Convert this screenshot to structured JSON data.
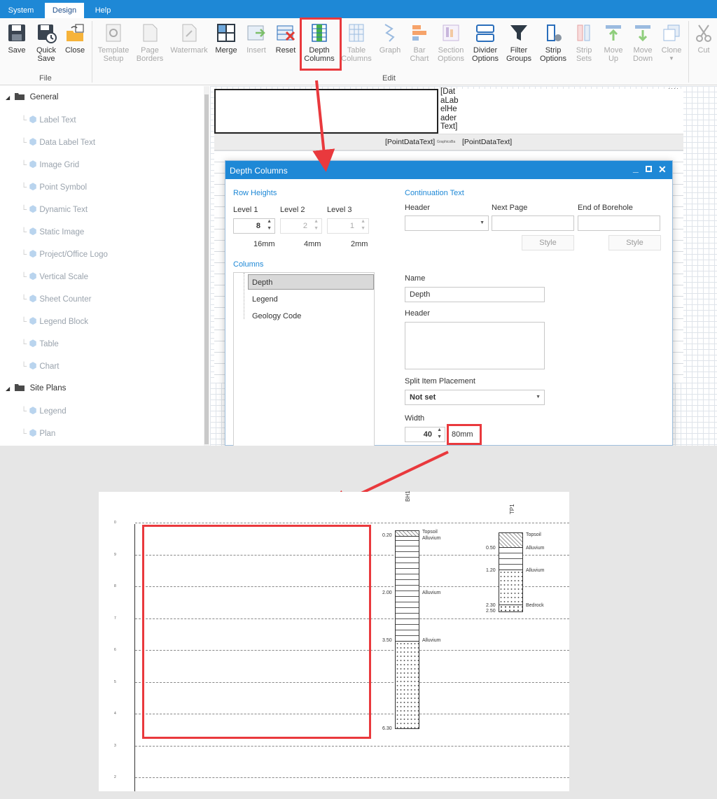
{
  "tabs": [
    {
      "label": "System",
      "active": false
    },
    {
      "label": "Design",
      "active": true
    },
    {
      "label": "Help",
      "active": false
    }
  ],
  "ribbon": {
    "file_group": "File",
    "edit_group": "Edit",
    "buttons": {
      "save": {
        "label": "Save",
        "enabled": true
      },
      "quick_save": {
        "label": "Quick\nSave",
        "enabled": true
      },
      "close": {
        "label": "Close",
        "enabled": true
      },
      "template_setup": {
        "label": "Template\nSetup",
        "enabled": false
      },
      "page_borders": {
        "label": "Page\nBorders",
        "enabled": false
      },
      "watermark": {
        "label": "Watermark",
        "enabled": false
      },
      "merge": {
        "label": "Merge",
        "enabled": true
      },
      "insert": {
        "label": "Insert",
        "enabled": false
      },
      "reset": {
        "label": "Reset",
        "enabled": true
      },
      "depth_columns": {
        "label": "Depth\nColumns",
        "enabled": true
      },
      "table_columns": {
        "label": "Table\nColumns",
        "enabled": false
      },
      "graph": {
        "label": "Graph",
        "enabled": false
      },
      "bar_chart": {
        "label": "Bar\nChart",
        "enabled": false
      },
      "section_options": {
        "label": "Section\nOptions",
        "enabled": false
      },
      "divider_options": {
        "label": "Divider\nOptions",
        "enabled": true
      },
      "filter_groups": {
        "label": "Filter\nGroups",
        "enabled": true
      },
      "strip_options": {
        "label": "Strip\nOptions",
        "enabled": true
      },
      "strip_sets": {
        "label": "Strip\nSets",
        "enabled": false
      },
      "move_up": {
        "label": "Move\nUp",
        "enabled": false
      },
      "move_down": {
        "label": "Move\nDown",
        "enabled": false
      },
      "clone": {
        "label": "Clone",
        "enabled": false
      },
      "cut": {
        "label": "Cut",
        "enabled": false
      }
    }
  },
  "tree": {
    "groups": [
      {
        "label": "General",
        "items": [
          "Label Text",
          "Data Label Text",
          "Image Grid",
          "Point Symbol",
          "Dynamic Text",
          "Static Image",
          "Project/Office Logo",
          "Vertical Scale",
          "Sheet Counter",
          "Legend Block",
          "Table",
          "Chart"
        ]
      },
      {
        "label": "Site Plans",
        "items": [
          "Legend",
          "Plan"
        ]
      }
    ]
  },
  "canvas": {
    "header_text_lines": [
      "[Dat",
      "aLab",
      "elHe",
      "ader",
      "Text]"
    ],
    "point_data_text": "[PointDataText]",
    "graphics_text": "GraphicsBa",
    "point_data_text_2": "[PointDataText]"
  },
  "dialog": {
    "title": "Depth Columns",
    "row_heights": {
      "section": "Row Heights",
      "level1_label": "Level 1",
      "level2_label": "Level 2",
      "level3_label": "Level 3",
      "level1_value": "8",
      "level2_value": "2",
      "level3_value": "1",
      "level1_mm": "16mm",
      "level2_mm": "4mm",
      "level3_mm": "2mm"
    },
    "continuation": {
      "section": "Continuation Text",
      "header_label": "Header",
      "next_page_label": "Next Page",
      "end_label": "End of Borehole",
      "header_value": "",
      "next_page_value": "",
      "end_value": "",
      "style1": "Style",
      "style2": "Style"
    },
    "columns": {
      "section": "Columns",
      "items": [
        "Depth",
        "Legend",
        "Geology Code"
      ],
      "selected": "Depth"
    },
    "props": {
      "name_label": "Name",
      "name_value": "Depth",
      "header_label": "Header",
      "header_value": "",
      "split_label": "Split Item Placement",
      "split_value": "Not set",
      "width_label": "Width",
      "width_value": "40",
      "width_mm": "80mm"
    }
  },
  "preview": {
    "y_ticks": [
      "0",
      "9",
      "8",
      "7",
      "6",
      "5",
      "4",
      "3",
      "2"
    ],
    "boreholes": [
      {
        "name": "BH1",
        "depths": [
          "0.20",
          "2.00",
          "3.50",
          "6.30"
        ],
        "geology": [
          "Topsoil",
          "Alluvium",
          "Alluvium",
          "Alluvium"
        ]
      },
      {
        "name": "TP1",
        "depths": [
          "0.50",
          "1.20",
          "2.30",
          "2.50"
        ],
        "geology": [
          "Topsoil",
          "Alluvium",
          "Alluvium",
          "Bedrock"
        ]
      }
    ]
  },
  "colors": {
    "accent": "#1e88d6",
    "highlight": "#e9393d",
    "grid": "#dfe4ea"
  }
}
